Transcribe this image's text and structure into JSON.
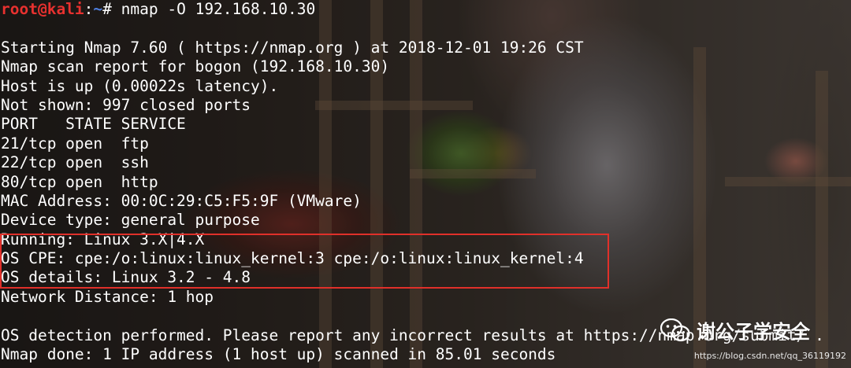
{
  "terminal": {
    "prompt": {
      "user_host": "root@kali",
      "separator": ":",
      "path": "~",
      "symbol": "#",
      "command": " nmap -O 192.168.10.30"
    },
    "lines": [
      "",
      "Starting Nmap 7.60 ( https://nmap.org ) at 2018-12-01 19:26 CST",
      "Nmap scan report for bogon (192.168.10.30)",
      "Host is up (0.00022s latency).",
      "Not shown: 997 closed ports",
      "PORT   STATE SERVICE",
      "21/tcp open  ftp",
      "22/tcp open  ssh",
      "80/tcp open  http",
      "MAC Address: 00:0C:29:C5:F5:9F (VMware)",
      "Device type: general purpose",
      "Running: Linux 3.X|4.X",
      "OS CPE: cpe:/o:linux:linux_kernel:3 cpe:/o:linux:linux_kernel:4",
      "OS details: Linux 3.2 - 4.8",
      "Network Distance: 1 hop",
      "",
      "OS detection performed. Please report any incorrect results at https://nmap.org/submit/ .",
      "Nmap done: 1 IP address (1 host up) scanned in 85.01 seconds"
    ]
  },
  "watermark": {
    "icon": "wechat-icon",
    "text": "谢公子学安全",
    "url": "https://blog.csdn.net/qq_36119192"
  },
  "colors": {
    "prompt_user": "#e8312f",
    "prompt_path": "#4f7fe0",
    "text": "#ffffff",
    "highlight": "#e0302a"
  }
}
